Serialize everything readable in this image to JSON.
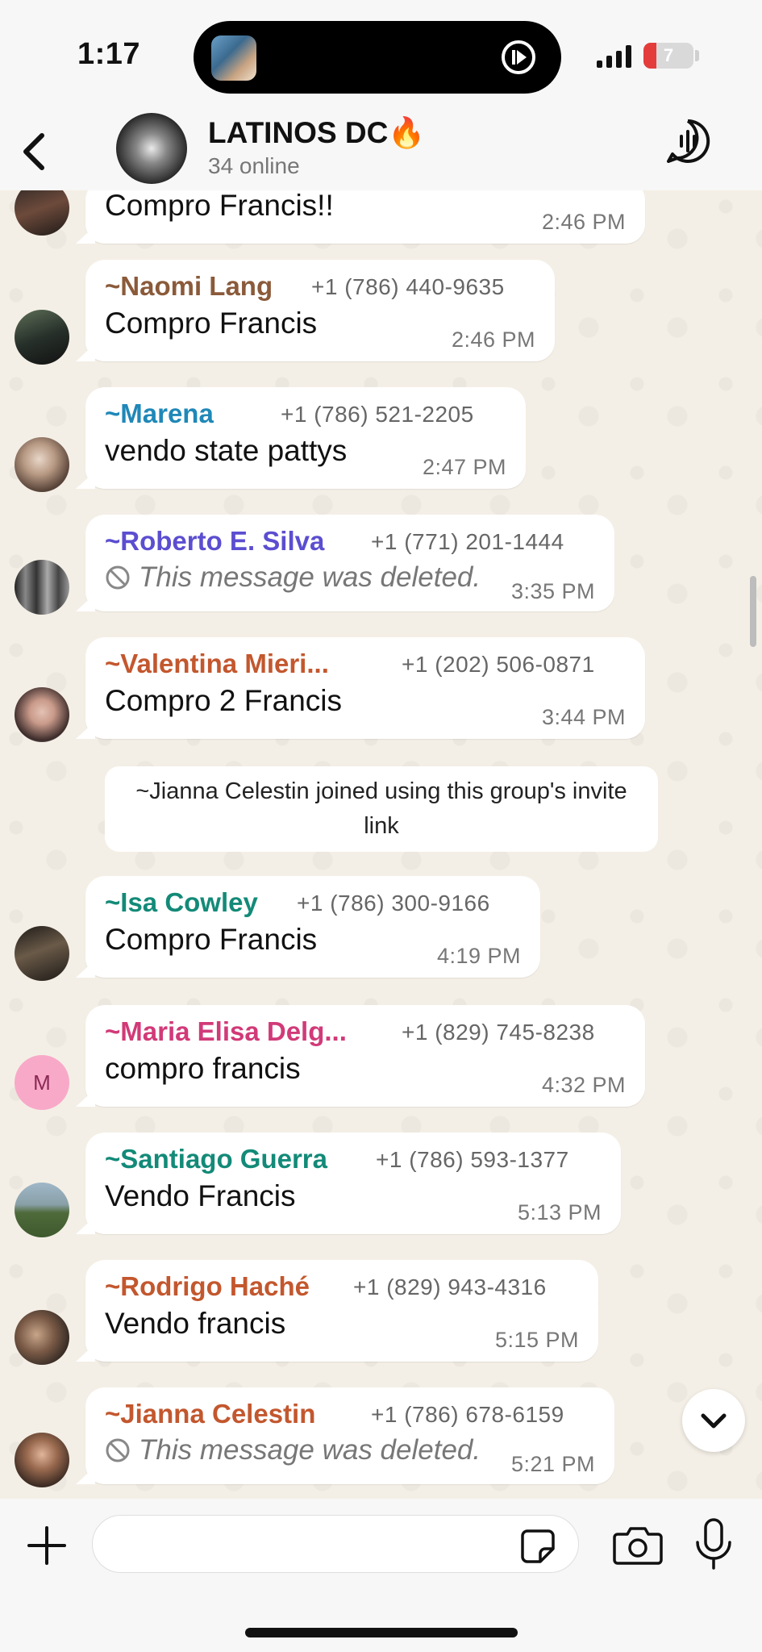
{
  "status_bar": {
    "time": "1:17",
    "battery": "7",
    "battery_level_percent": 7
  },
  "header": {
    "title": "LATINOS DC🔥",
    "subtitle": "34 online"
  },
  "messages": [
    {
      "text": "Compro Francis!!",
      "time": "2:46 PM"
    },
    {
      "sender": "~Naomi Lang",
      "phone": "+1 (786) 440-9635",
      "text": "Compro Francis",
      "time": "2:46 PM",
      "color": "#8a5a3a"
    },
    {
      "sender": "~Marena",
      "phone": "+1 (786) 521-2205",
      "text": "vendo state pattys",
      "time": "2:47 PM",
      "color": "#1f88b8"
    },
    {
      "sender": "~Roberto E. Silva",
      "phone": "+1 (771) 201-1444",
      "text": "This message was deleted.",
      "time": "3:35 PM",
      "color": "#5b4ed0"
    },
    {
      "sender": "~Valentina Mieri...",
      "phone": "+1 (202) 506-0871",
      "text": "Compro 2 Francis",
      "time": "3:44 PM",
      "color": "#c3572e"
    },
    {
      "sender": "~Isa Cowley",
      "phone": "+1 (786) 300-9166",
      "text": "Compro Francis",
      "time": "4:19 PM",
      "color": "#138a78"
    },
    {
      "sender": "~Maria Elisa Delg...",
      "phone": "+1 (829) 745-8238",
      "text": "compro francis",
      "time": "4:32 PM",
      "color": "#d13a78",
      "avatar_letter": "M"
    },
    {
      "sender": "~Santiago Guerra",
      "phone": "+1 (786) 593-1377",
      "text": "Vendo Francis",
      "time": "5:13 PM",
      "color": "#138a78"
    },
    {
      "sender": "~Rodrigo Haché",
      "phone": "+1 (829) 943-4316",
      "text": "Vendo francis",
      "time": "5:15 PM",
      "color": "#c3572e"
    },
    {
      "sender": "~Jianna Celestin",
      "phone": "+1 (786) 678-6159",
      "text": "This message was deleted.",
      "time": "5:21 PM",
      "color": "#c3572e"
    }
  ],
  "system_message": "~Jianna Celestin joined using this group's invite link",
  "composer": {
    "placeholder": ""
  }
}
